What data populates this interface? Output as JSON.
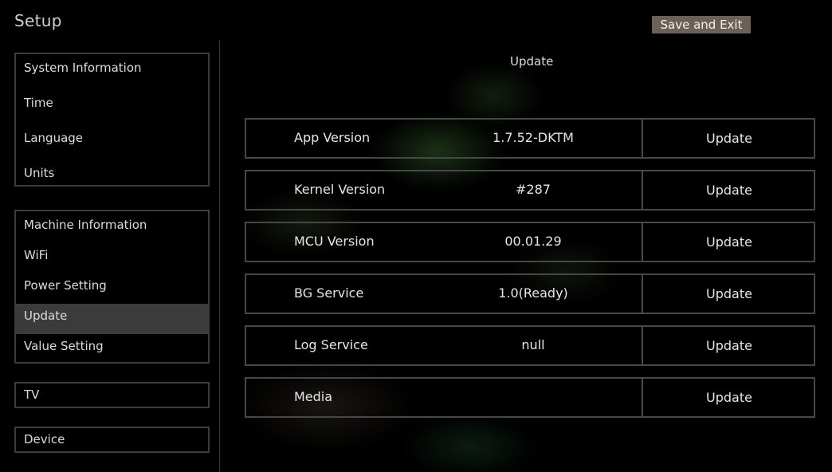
{
  "header": {
    "title": "Setup",
    "save_exit_label": "Save and Exit"
  },
  "sidebar": {
    "group1": [
      {
        "label": "System Information"
      },
      {
        "label": "Time"
      },
      {
        "label": "Language"
      },
      {
        "label": "Units"
      }
    ],
    "group2": [
      {
        "label": "Machine Information"
      },
      {
        "label": "WiFi"
      },
      {
        "label": "Power Setting"
      },
      {
        "label": "Update"
      },
      {
        "label": "Value Setting"
      }
    ],
    "group3": [
      {
        "label": "TV"
      }
    ],
    "group4": [
      {
        "label": "Device"
      }
    ],
    "selected": "Update"
  },
  "main": {
    "section_title": "Update",
    "rows": [
      {
        "label": "App Version",
        "value": "1.7.52-DKTM",
        "action": "Update"
      },
      {
        "label": "Kernel Version",
        "value": "#287",
        "action": "Update"
      },
      {
        "label": "MCU Version",
        "value": "00.01.29",
        "action": "Update"
      },
      {
        "label": "BG Service",
        "value": "1.0(Ready)",
        "action": "Update"
      },
      {
        "label": "Log Service",
        "value": "null",
        "action": "Update"
      },
      {
        "label": "Media",
        "value": "",
        "action": "Update"
      }
    ]
  },
  "colors": {
    "background": "#000000",
    "save_button_bg": "#6b6157",
    "selected_item_bg": "#3b3b3b",
    "border": "#474747"
  }
}
